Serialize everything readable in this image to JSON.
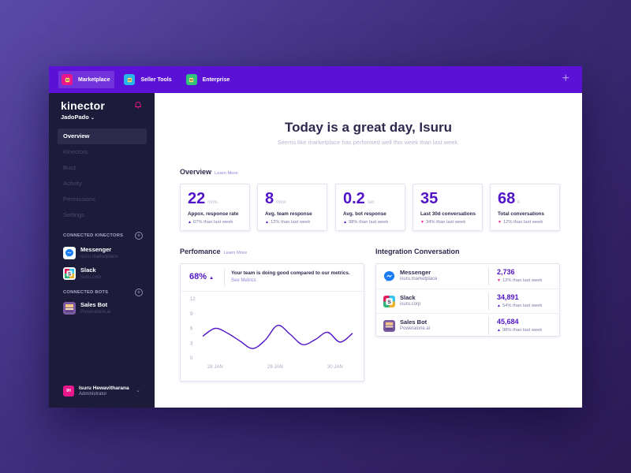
{
  "topbar": {
    "tabs": [
      {
        "label": "Marketplace",
        "icon": "robot-icon",
        "color": "#e8188a"
      },
      {
        "label": "Seller Tools",
        "icon": "robot-icon",
        "color": "#27b6e8"
      },
      {
        "label": "Enterprise",
        "icon": "robot-icon",
        "color": "#2fc37d"
      }
    ],
    "add_icon": "+"
  },
  "sidebar": {
    "brand": "kinector",
    "org": "JadoPado",
    "nav": [
      "Overview",
      "Kinectors",
      "Buzz",
      "Activity",
      "Permissions",
      "Settings"
    ],
    "connected_kinectors_title": "CONNECTED KINECTORS",
    "kinectors": [
      {
        "name": "Messenger",
        "sub": "isuru.marketplace"
      },
      {
        "name": "Slack",
        "sub": "isuru.corp"
      }
    ],
    "connected_bots_title": "CONNECTED BOTS",
    "bots": [
      {
        "name": "Sales Bot",
        "sub": "Poweralone.ai"
      }
    ],
    "user": {
      "initials": "IH",
      "name": "Isuru Hewavitharana",
      "role": "Administrator"
    }
  },
  "main": {
    "headline": "Today is a great day, Isuru",
    "subline": "Seems like marketplace has performed well this week than last week.",
    "overview_title": "Overview",
    "learn_more": "Learn More",
    "stats": [
      {
        "value": "22",
        "unit": "mins",
        "label": "Appox. response rate",
        "trend": "67% than last week",
        "direction": "up"
      },
      {
        "value": "8",
        "unit": "mins",
        "label": "Avg. team response",
        "trend": "12% than last week",
        "direction": "up"
      },
      {
        "value": "0.2",
        "unit": "sec",
        "label": "Avg. bot response",
        "trend": "98% than last week",
        "direction": "up"
      },
      {
        "value": "35",
        "unit": "",
        "label": "Last 30d conversations",
        "trend": "34% than last week",
        "direction": "down"
      },
      {
        "value": "68",
        "unit": "k",
        "label": "Total conversations",
        "trend": "12% than last week",
        "direction": "down"
      }
    ],
    "performance": {
      "title": "Perfomance",
      "learn_more": "Learn More",
      "percent": "68%",
      "message": "Your team is doing good compared to our metrics.",
      "link": "See Metrics"
    },
    "integration": {
      "title": "Integration Conversation",
      "rows": [
        {
          "name": "Messenger",
          "sub": "isuru.marketplace",
          "value": "2,736",
          "trend": "12% than last week",
          "direction": "down"
        },
        {
          "name": "Slack",
          "sub": "isuru.corp",
          "value": "34,891",
          "trend": "54% than last week",
          "direction": "up"
        },
        {
          "name": "Sales Bot",
          "sub": "Poweralone.ai",
          "value": "45,684",
          "trend": "98% than last week",
          "direction": "up"
        }
      ]
    }
  },
  "chart_data": {
    "type": "line",
    "yticks": [
      "12",
      "9",
      "6",
      "3",
      "0"
    ],
    "ylim": [
      0,
      12
    ],
    "xticks": [
      "28 JAN",
      "29 JAN",
      "30 JAN"
    ],
    "x": [
      0,
      1,
      2,
      3,
      4,
      5,
      6,
      7,
      8,
      9,
      10,
      11,
      12
    ],
    "series": [
      {
        "values": [
          4.4,
          6.0,
          5.0,
          3.4,
          1.9,
          3.6,
          6.6,
          4.8,
          2.7,
          3.7,
          5.2,
          3.2,
          5.0
        ]
      }
    ],
    "colors": {
      "line": "#5214c8"
    }
  }
}
